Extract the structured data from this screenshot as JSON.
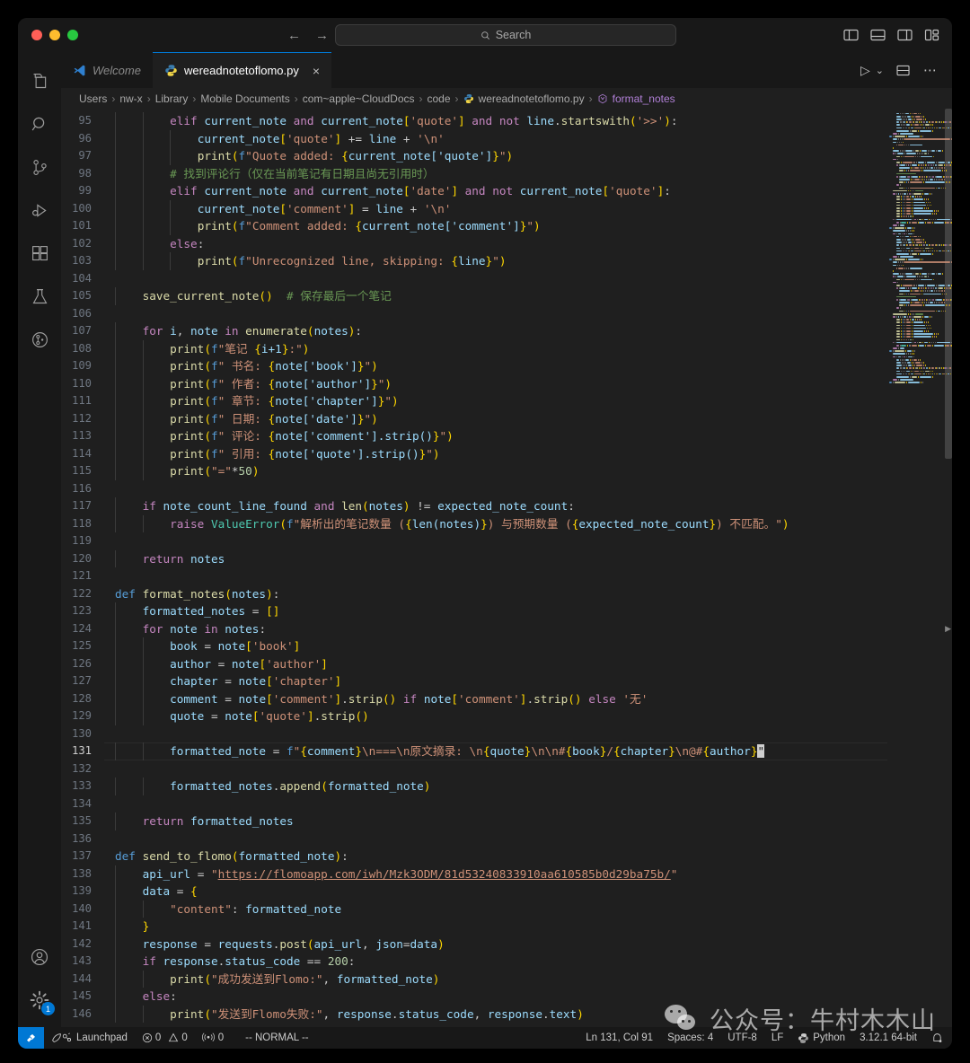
{
  "window": {
    "traffic_lights": [
      "close",
      "minimize",
      "maximize"
    ],
    "search_placeholder": "Search",
    "search_icon": "search-icon"
  },
  "tabs": [
    {
      "label": "Welcome",
      "icon": "vscode-logo-icon",
      "active": false
    },
    {
      "label": "wereadnotetoflomo.py",
      "icon": "python-file-icon",
      "active": true,
      "close": "×"
    }
  ],
  "editor_actions": {
    "run": "▷",
    "run_chevron": "⌄",
    "split_editor": "split-editor-icon",
    "more": "⋯"
  },
  "layout_actions": [
    "toggle-primary-sidebar",
    "toggle-panel",
    "toggle-secondary-sidebar",
    "customize-layout"
  ],
  "breadcrumb": [
    "Users",
    "nw-x",
    "Library",
    "Mobile Documents",
    "com~apple~CloudDocs",
    "code",
    "wereadnotetoflomo.py",
    "format_notes"
  ],
  "activity_bar": [
    "explorer-icon",
    "search-icon",
    "source-control-icon",
    "run-and-debug-icon",
    "extensions-icon",
    "testing-icon",
    "remote-explorer-icon"
  ],
  "activity_bar_bottom": [
    {
      "name": "accounts-icon",
      "badge": null
    },
    {
      "name": "settings-gear-icon",
      "badge": "1"
    }
  ],
  "status_bar": {
    "remote_label": "Launchpad",
    "remote_icon": "remote-indicator-icon",
    "errors_icon": "error-icon",
    "errors": "0",
    "warnings_icon": "warning-icon",
    "warnings": "0",
    "ports_icon": "radio-tower-icon",
    "ports": "0",
    "mode": "-- NORMAL --",
    "cursor_position": "Ln 131, Col 91",
    "indentation": "Spaces: 4",
    "encoding": "UTF-8",
    "eol": "LF",
    "language_icon": "python-icon",
    "language": "Python",
    "interpreter": "3.12.1 64-bit",
    "notifications_icon": "bell-icon",
    "accent_color": "#0078d4"
  },
  "watermark": {
    "text": "公众号：牛村木木山",
    "icon": "wechat-icon"
  },
  "code": {
    "first_line_number": 95,
    "cursor_line": 131,
    "lines": [
      {
        "n": 95,
        "t": "        elif current_note and current_note['quote'] and not line.startswith('>>'):"
      },
      {
        "n": 96,
        "t": "            current_note['quote'] += line + '\\n'"
      },
      {
        "n": 97,
        "t": "            print(f\"Quote added: {current_note['quote']}\")"
      },
      {
        "n": 98,
        "t": "        # 找到评论行（仅在当前笔记有日期且尚无引用时）"
      },
      {
        "n": 99,
        "t": "        elif current_note and current_note['date'] and not current_note['quote']:"
      },
      {
        "n": 100,
        "t": "            current_note['comment'] = line + '\\n'"
      },
      {
        "n": 101,
        "t": "            print(f\"Comment added: {current_note['comment']}\")"
      },
      {
        "n": 102,
        "t": "        else:"
      },
      {
        "n": 103,
        "t": "            print(f\"Unrecognized line, skipping: {line}\")"
      },
      {
        "n": 104,
        "t": ""
      },
      {
        "n": 105,
        "t": "    save_current_note()  # 保存最后一个笔记"
      },
      {
        "n": 106,
        "t": ""
      },
      {
        "n": 107,
        "t": "    for i, note in enumerate(notes):"
      },
      {
        "n": 108,
        "t": "        print(f\"笔记 {i+1}:\")"
      },
      {
        "n": 109,
        "t": "        print(f\" 书名: {note['book']}\")"
      },
      {
        "n": 110,
        "t": "        print(f\" 作者: {note['author']}\")"
      },
      {
        "n": 111,
        "t": "        print(f\" 章节: {note['chapter']}\")"
      },
      {
        "n": 112,
        "t": "        print(f\" 日期: {note['date']}\")"
      },
      {
        "n": 113,
        "t": "        print(f\" 评论: {note['comment'].strip()}\")"
      },
      {
        "n": 114,
        "t": "        print(f\" 引用: {note['quote'].strip()}\")"
      },
      {
        "n": 115,
        "t": "        print(\"=\"*50)"
      },
      {
        "n": 116,
        "t": ""
      },
      {
        "n": 117,
        "t": "    if note_count_line_found and len(notes) != expected_note_count:"
      },
      {
        "n": 118,
        "t": "        raise ValueError(f\"解析出的笔记数量 ({len(notes)}) 与预期数量 ({expected_note_count}) 不匹配。\")"
      },
      {
        "n": 119,
        "t": ""
      },
      {
        "n": 120,
        "t": "    return notes"
      },
      {
        "n": 121,
        "t": ""
      },
      {
        "n": 122,
        "t": "def format_notes(notes):"
      },
      {
        "n": 123,
        "t": "    formatted_notes = []"
      },
      {
        "n": 124,
        "t": "    for note in notes:"
      },
      {
        "n": 125,
        "t": "        book = note['book']"
      },
      {
        "n": 126,
        "t": "        author = note['author']"
      },
      {
        "n": 127,
        "t": "        chapter = note['chapter']"
      },
      {
        "n": 128,
        "t": "        comment = note['comment'].strip() if note['comment'].strip() else '无'"
      },
      {
        "n": 129,
        "t": "        quote = note['quote'].strip()"
      },
      {
        "n": 130,
        "t": ""
      },
      {
        "n": 131,
        "t": "        formatted_note = f\"{comment}\\n===\\n原文摘录: \\n{quote}\\n\\n#{book}/{chapter}\\n@#{author}\""
      },
      {
        "n": 132,
        "t": ""
      },
      {
        "n": 133,
        "t": "        formatted_notes.append(formatted_note)"
      },
      {
        "n": 134,
        "t": ""
      },
      {
        "n": 135,
        "t": "    return formatted_notes"
      },
      {
        "n": 136,
        "t": ""
      },
      {
        "n": 137,
        "t": "def send_to_flomo(formatted_note):"
      },
      {
        "n": 138,
        "t": "    api_url = \"https://flomoapp.com/iwh/Mzk3ODM/81d53240833910aa610585b0d29ba75b/\""
      },
      {
        "n": 139,
        "t": "    data = {"
      },
      {
        "n": 140,
        "t": "        \"content\": formatted_note"
      },
      {
        "n": 141,
        "t": "    }"
      },
      {
        "n": 142,
        "t": "    response = requests.post(api_url, json=data)"
      },
      {
        "n": 143,
        "t": "    if response.status_code == 200:"
      },
      {
        "n": 144,
        "t": "        print(\"成功发送到Flomo:\", formatted_note)"
      },
      {
        "n": 145,
        "t": "    else:"
      },
      {
        "n": 146,
        "t": "        print(\"发送到Flomo失败:\", response.status_code, response.text)"
      }
    ]
  },
  "theme": {
    "background": "#1f1f1f",
    "chrome": "#181818",
    "accent": "#0078d4",
    "keyword": "#c586c0",
    "string": "#ce9178",
    "comment": "#6a9955",
    "function": "#dcdcaa",
    "variable": "#9cdcfe",
    "number": "#b5cea8",
    "class": "#4ec9b0",
    "bracket1": "#ffd700",
    "bracket2": "#da70d6",
    "bracket3": "#179fff"
  }
}
